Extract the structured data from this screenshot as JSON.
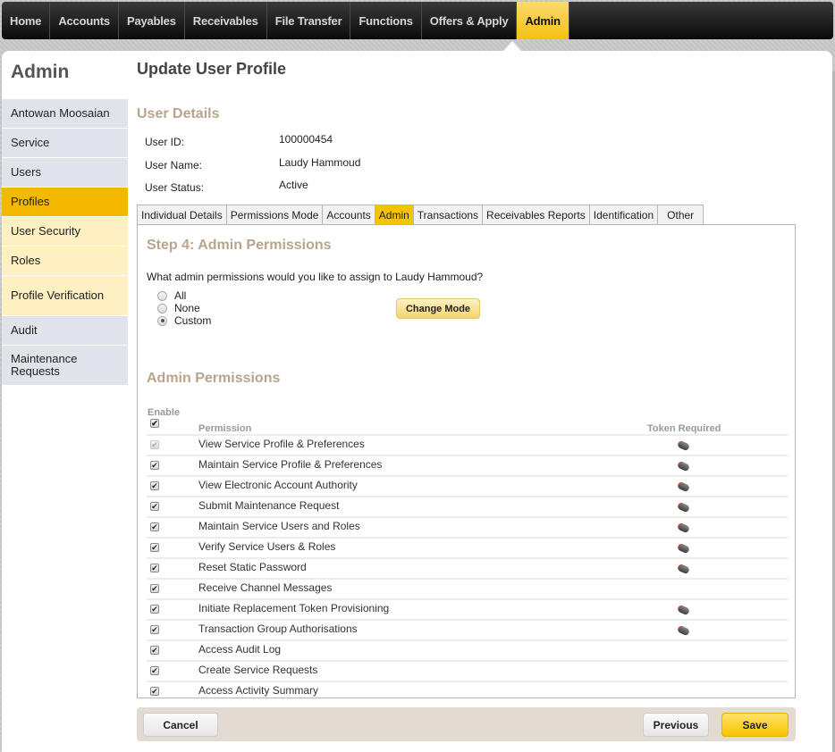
{
  "topnav": {
    "items": [
      {
        "label": "Home",
        "active": false
      },
      {
        "label": "Accounts",
        "active": false
      },
      {
        "label": "Payables",
        "active": false
      },
      {
        "label": "Receivables",
        "active": false
      },
      {
        "label": "File Transfer",
        "active": false
      },
      {
        "label": "Functions",
        "active": false
      },
      {
        "label": "Offers & Apply",
        "active": false
      },
      {
        "label": "Admin",
        "active": true
      }
    ]
  },
  "sidebar": {
    "title": "Admin",
    "items": [
      {
        "label": "Antowan Moosaian",
        "state": "normal"
      },
      {
        "label": "Service",
        "state": "normal"
      },
      {
        "label": "Users",
        "state": "normal"
      },
      {
        "label": "Profiles",
        "state": "active"
      },
      {
        "label": "User Security",
        "state": "sub"
      },
      {
        "label": "Roles",
        "state": "sub"
      },
      {
        "label": "Profile Verification",
        "state": "sub"
      },
      {
        "label": "Audit",
        "state": "normal"
      },
      {
        "label": "Maintenance Requests",
        "state": "normal"
      }
    ]
  },
  "page": {
    "title": "Update User Profile",
    "user_details_title": "User Details",
    "details": [
      {
        "label": "User ID:",
        "value": "100000454"
      },
      {
        "label": "User Name:",
        "value": "Laudy Hammoud"
      },
      {
        "label": "User Status:",
        "value": "Active"
      }
    ]
  },
  "tabs": [
    {
      "label": "Individual Details",
      "active": false
    },
    {
      "label": "Permissions Mode",
      "active": false
    },
    {
      "label": "Accounts",
      "active": false
    },
    {
      "label": "Admin",
      "active": true
    },
    {
      "label": "Transactions",
      "active": false
    },
    {
      "label": "Receivables Reports",
      "active": false
    },
    {
      "label": "Identification",
      "active": false
    },
    {
      "label": "Other",
      "active": false
    }
  ],
  "step": {
    "title": "Step 4: Admin Permissions",
    "question": "What admin permissions would you like to assign to Laudy Hammoud?",
    "options": [
      {
        "label": "All",
        "checked": false
      },
      {
        "label": "None",
        "checked": false
      },
      {
        "label": "Custom",
        "checked": true
      }
    ],
    "change_mode_label": "Change Mode"
  },
  "permissions": {
    "title": "Admin Permissions",
    "header_enable": "Enable",
    "header_permission": "Permission",
    "header_token": "Token Required",
    "select_all_checked": true,
    "rows": [
      {
        "name": "View Service Profile & Preferences",
        "enabled": true,
        "disabled": true,
        "token": true
      },
      {
        "name": "Maintain Service Profile & Preferences",
        "enabled": true,
        "disabled": false,
        "token": true
      },
      {
        "name": "View Electronic Account Authority",
        "enabled": true,
        "disabled": false,
        "token": true
      },
      {
        "name": "Submit Maintenance Request",
        "enabled": true,
        "disabled": false,
        "token": true
      },
      {
        "name": "Maintain Service Users and Roles",
        "enabled": true,
        "disabled": false,
        "token": true
      },
      {
        "name": "Verify Service Users & Roles",
        "enabled": true,
        "disabled": false,
        "token": true
      },
      {
        "name": "Reset Static Password",
        "enabled": true,
        "disabled": false,
        "token": true
      },
      {
        "name": "Receive Channel Messages",
        "enabled": true,
        "disabled": false,
        "token": false
      },
      {
        "name": "Initiate Replacement Token Provisioning",
        "enabled": true,
        "disabled": false,
        "token": true
      },
      {
        "name": "Transaction Group Authorisations",
        "enabled": true,
        "disabled": false,
        "token": true
      },
      {
        "name": "Access Audit Log",
        "enabled": true,
        "disabled": false,
        "token": false
      },
      {
        "name": "Create Service Requests",
        "enabled": true,
        "disabled": false,
        "token": false
      },
      {
        "name": "Access Activity Summary",
        "enabled": true,
        "disabled": false,
        "token": false
      }
    ]
  },
  "footer": {
    "cancel_label": "Cancel",
    "previous_label": "Previous",
    "save_label": "Save"
  },
  "icons": {
    "checkmark": "✔",
    "token": "security-token-icon"
  }
}
